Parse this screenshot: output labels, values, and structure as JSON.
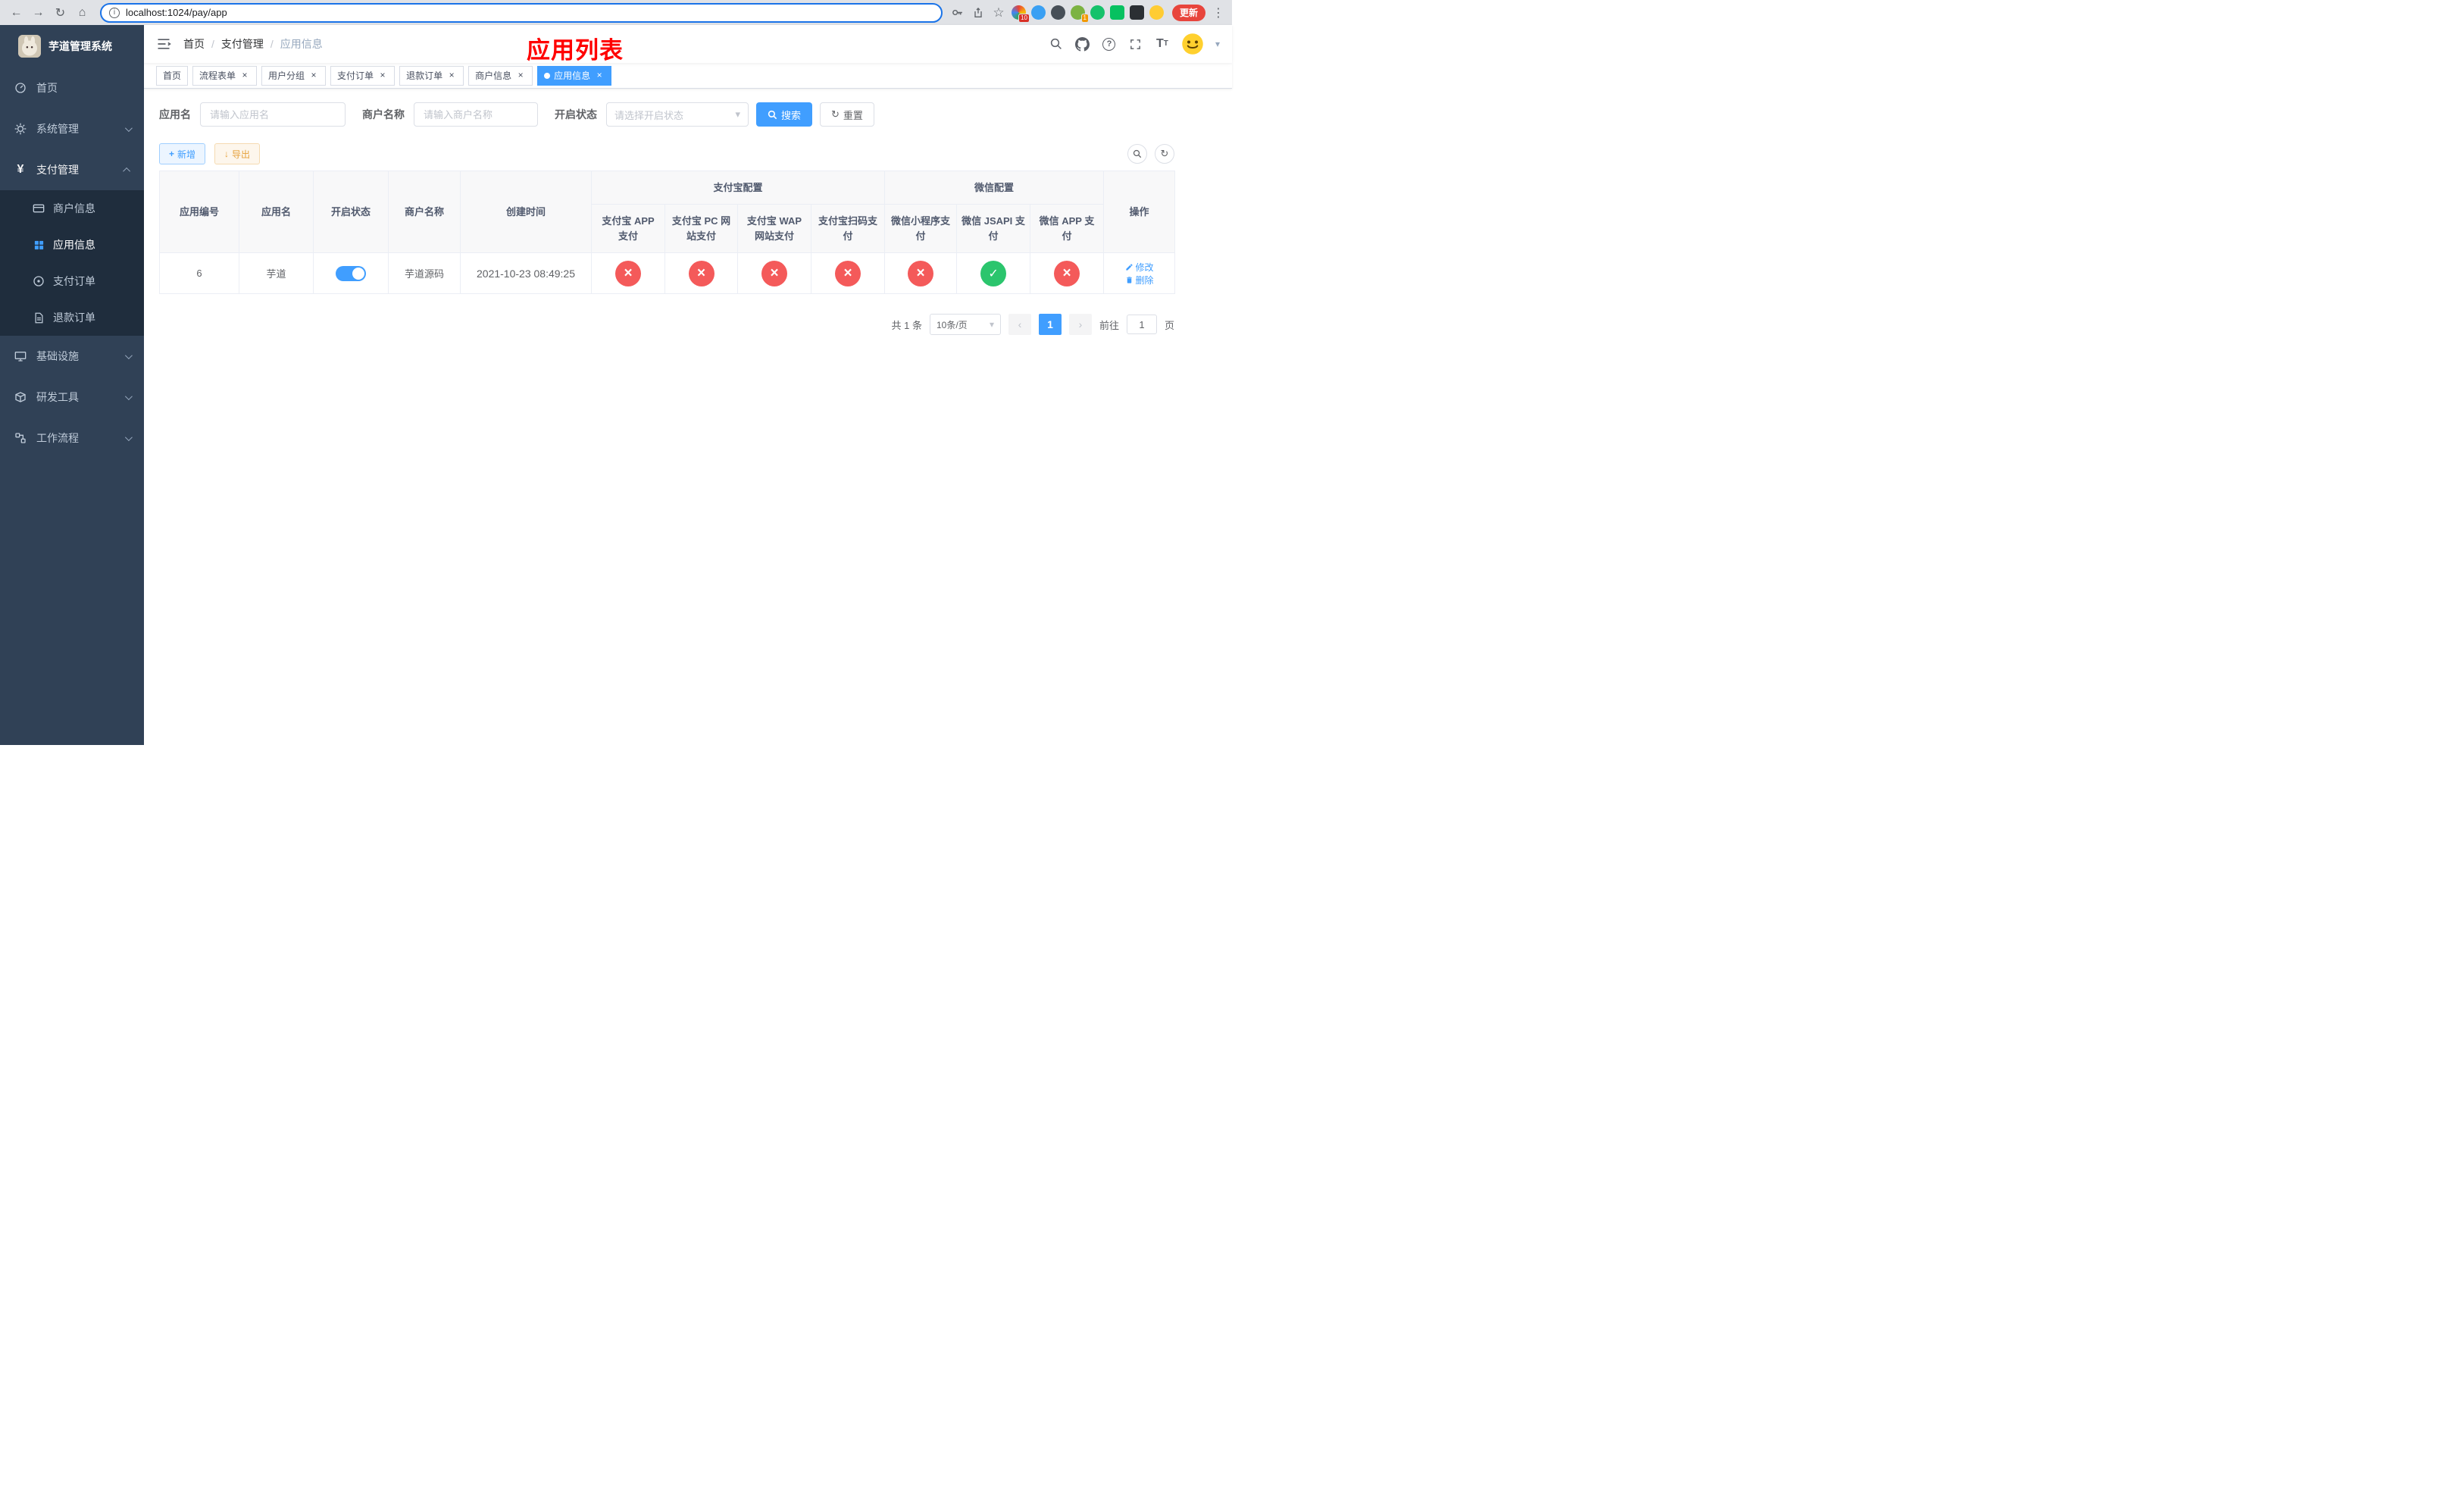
{
  "browser": {
    "url": "localhost:1024/pay/app",
    "update_label": "更新",
    "extension_badge_1": "10",
    "extension_badge_2": "1"
  },
  "sidebar": {
    "title": "芋道管理系统",
    "items": [
      {
        "label": "首页"
      },
      {
        "label": "系统管理"
      },
      {
        "label": "支付管理",
        "children": [
          {
            "label": "商户信息"
          },
          {
            "label": "应用信息"
          },
          {
            "label": "支付订单"
          },
          {
            "label": "退款订单"
          }
        ]
      },
      {
        "label": "基础设施"
      },
      {
        "label": "研发工具"
      },
      {
        "label": "工作流程"
      }
    ]
  },
  "navbar": {
    "breadcrumb": {
      "home": "首页",
      "section": "支付管理",
      "current": "应用信息"
    },
    "overlay_title": "应用列表"
  },
  "tabs": [
    {
      "label": "首页"
    },
    {
      "label": "流程表单"
    },
    {
      "label": "用户分组"
    },
    {
      "label": "支付订单"
    },
    {
      "label": "退款订单"
    },
    {
      "label": "商户信息"
    },
    {
      "label": "应用信息"
    }
  ],
  "filters": {
    "app_name_label": "应用名",
    "app_name_placeholder": "请输入应用名",
    "merchant_label": "商户名称",
    "merchant_placeholder": "请输入商户名称",
    "status_label": "开启状态",
    "status_placeholder": "请选择开启状态",
    "search_label": "搜索",
    "reset_label": "重置"
  },
  "toolbar": {
    "add_label": "新增",
    "export_label": "导出"
  },
  "table": {
    "headers": {
      "app_id": "应用编号",
      "app_name": "应用名",
      "status": "开启状态",
      "merchant": "商户名称",
      "created": "创建时间",
      "alipay_group": "支付宝配置",
      "wechat_group": "微信配置",
      "actions": "操作",
      "alipay_app": "支付宝 APP 支付",
      "alipay_pc": "支付宝 PC 网站支付",
      "alipay_wap": "支付宝 WAP 网站支付",
      "alipay_qr": "支付宝扫码支付",
      "wechat_mini": "微信小程序支付",
      "wechat_jsapi": "微信 JSAPI 支付",
      "wechat_app": "微信 APP 支付"
    },
    "row": {
      "app_id": "6",
      "app_name": "芋道",
      "status": "on",
      "merchant": "芋道源码",
      "created": "2021-10-23 08:49:25",
      "alipay_app": "fail",
      "alipay_pc": "fail",
      "alipay_wap": "fail",
      "alipay_qr": "fail",
      "wechat_mini": "fail",
      "wechat_jsapi": "success",
      "wechat_app": "fail",
      "edit_label": "修改",
      "delete_label": "删除"
    }
  },
  "pagination": {
    "total": "共 1 条",
    "page_size": "10条/页",
    "page": "1",
    "goto": "前往",
    "goto_value": "1",
    "unit": "页"
  },
  "colors": {
    "primary": "#409eff",
    "success": "#2bc56d",
    "danger": "#f45a5a",
    "sidebar_bg": "#304156",
    "submenu_bg": "#1f2d3d"
  }
}
